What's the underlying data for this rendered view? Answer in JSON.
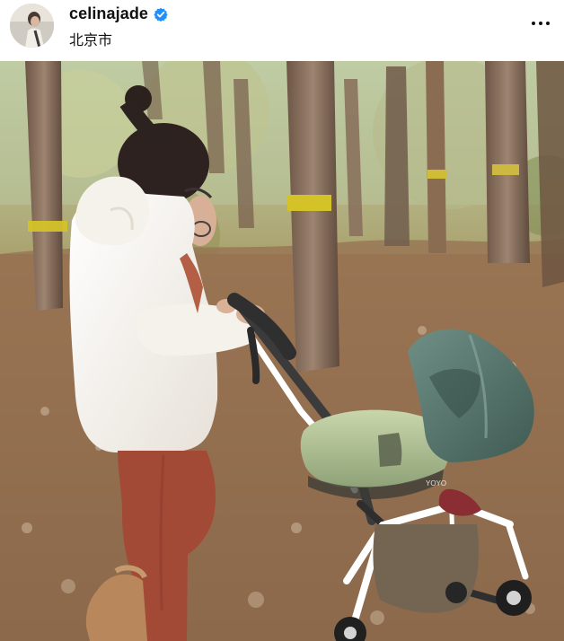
{
  "post": {
    "username": "celinajade",
    "location": "北京市",
    "verified": true
  },
  "icons": {
    "more": "more-horizontal-icon",
    "verified": "verified-badge-icon"
  },
  "photo": {
    "stroller_brand_text": "YOYO"
  },
  "colors": {
    "verified_blue": "#1f8fff",
    "stroller_canopy": "#55766c",
    "sweater": "#f2efe9",
    "pants": "#a34a37"
  }
}
